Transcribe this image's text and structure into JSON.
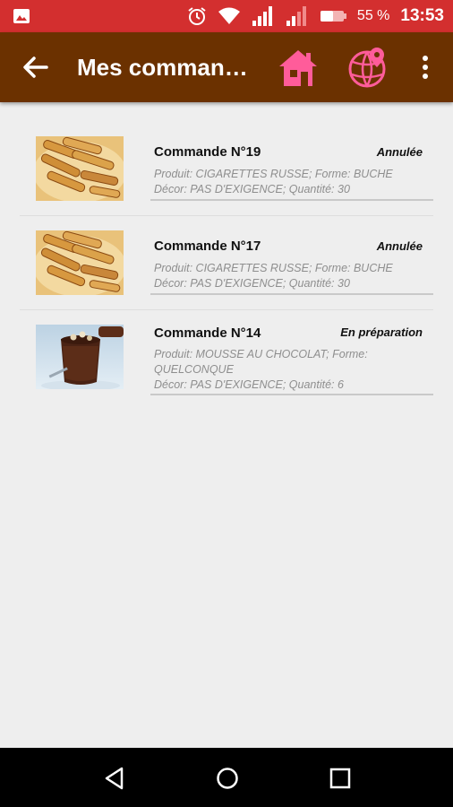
{
  "status_bar": {
    "battery_percent": "55 %",
    "time": "13:53"
  },
  "app_bar": {
    "title": "Mes commandes",
    "back_icon": "arrow-left-icon",
    "home_icon": "home-icon",
    "globe_icon": "globe-location-icon",
    "more_icon": "more-vertical-icon",
    "accent_color": "#ff5c9a",
    "bar_color": "#6b3100"
  },
  "orders": [
    {
      "name": "Commande N°19",
      "status": "Annulée",
      "line1": "Produit: CIGARETTES RUSSE; Forme: BUCHE",
      "line2": "Décor: PAS D'EXIGENCE; Quantité: 30",
      "image": "cigarettes-russes-photo"
    },
    {
      "name": "Commande N°17",
      "status": "Annulée",
      "line1": "Produit: CIGARETTES RUSSE; Forme: BUCHE",
      "line2": "Décor: PAS D'EXIGENCE; Quantité: 30",
      "image": "cigarettes-russes-photo"
    },
    {
      "name": "Commande N°14",
      "status": "En préparation",
      "line1": "Produit: MOUSSE AU CHOCOLAT; Forme:",
      "line1b": "QUELCONQUE",
      "line2": "Décor: PAS D'EXIGENCE; Quantité: 6",
      "image": "chocolate-mousse-photo"
    }
  ],
  "nav_bar": {
    "back": "triangle-back-icon",
    "home": "circle-home-icon",
    "recents": "square-recents-icon"
  }
}
